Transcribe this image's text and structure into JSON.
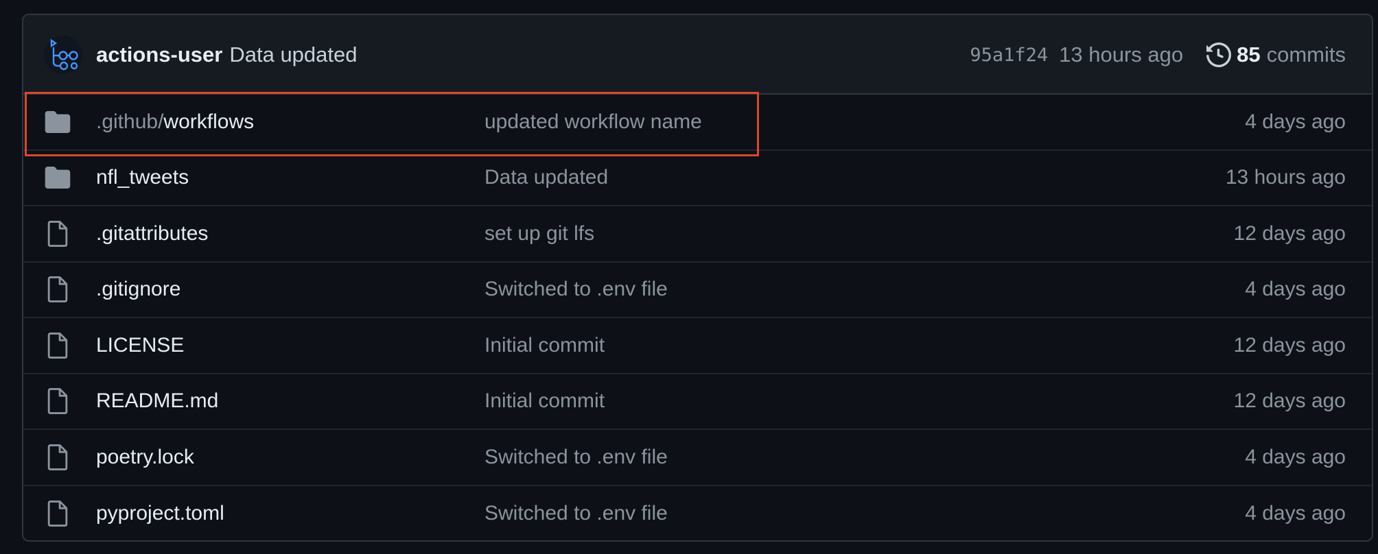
{
  "latest_commit": {
    "author": "actions-user",
    "message": "Data updated",
    "sha": "95a1f24",
    "time": "13 hours ago",
    "commits_count": "85",
    "commits_label": "commits",
    "avatar_icon": "github-actions-avatar-icon",
    "history_icon": "history-icon"
  },
  "files": [
    {
      "type": "folder",
      "prefix": ".github/",
      "name": "workflows",
      "message": "updated workflow name",
      "time": "4 days ago",
      "highlighted": true
    },
    {
      "type": "folder",
      "prefix": "",
      "name": "nfl_tweets",
      "message": "Data updated",
      "time": "13 hours ago"
    },
    {
      "type": "file",
      "prefix": "",
      "name": ".gitattributes",
      "message": "set up git lfs",
      "time": "12 days ago"
    },
    {
      "type": "file",
      "prefix": "",
      "name": ".gitignore",
      "message": "Switched to .env file",
      "time": "4 days ago"
    },
    {
      "type": "file",
      "prefix": "",
      "name": "LICENSE",
      "message": "Initial commit",
      "time": "12 days ago"
    },
    {
      "type": "file",
      "prefix": "",
      "name": "README.md",
      "message": "Initial commit",
      "time": "12 days ago"
    },
    {
      "type": "file",
      "prefix": "",
      "name": "poetry.lock",
      "message": "Switched to .env file",
      "time": "4 days ago"
    },
    {
      "type": "file",
      "prefix": "",
      "name": "pyproject.toml",
      "message": "Switched to .env file",
      "time": "4 days ago"
    }
  ],
  "colors": {
    "background": "#0d1117",
    "header_bg": "#161b22",
    "border": "#30363d",
    "highlight_border": "#e0452b",
    "icon": "#8b949e",
    "avatar_accent": "#4493f8"
  }
}
